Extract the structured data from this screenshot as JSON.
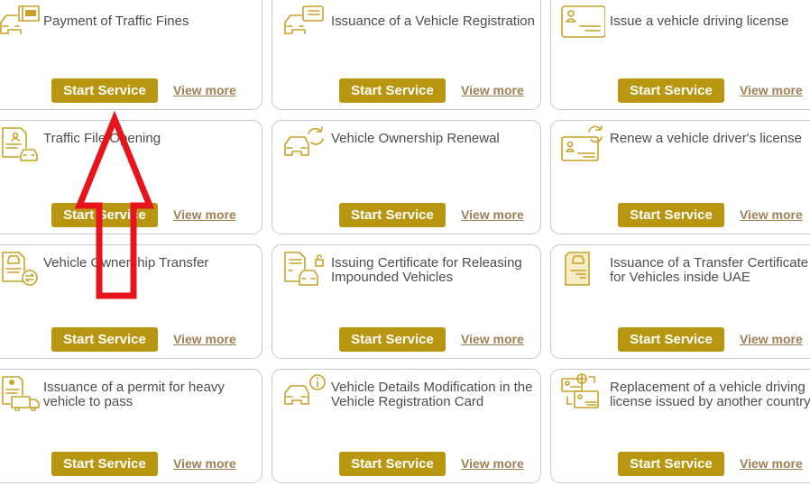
{
  "accent_color": "#b8960f",
  "link_color": "#a07f55",
  "annotation_color": "#e8141c",
  "services": [
    {
      "title": "Payment of Traffic Fines",
      "icon": "car-aed-ticket-icon",
      "start_label": "Start Service",
      "view_label": "View more"
    },
    {
      "title": "Issuance of a Vehicle Registration",
      "icon": "car-registration-card-icon",
      "start_label": "Start Service",
      "view_label": "View more"
    },
    {
      "title": "Issue a vehicle driving license",
      "icon": "driving-license-card-icon",
      "start_label": "Start Service",
      "view_label": "View more"
    },
    {
      "title": "Traffic File Opening",
      "icon": "document-car-icon",
      "start_label": "Start Service",
      "view_label": "View more"
    },
    {
      "title": "Vehicle Ownership Renewal",
      "icon": "car-renew-icon",
      "start_label": "Start Service",
      "view_label": "View more"
    },
    {
      "title": "Renew a vehicle driver's license",
      "icon": "license-renew-icon",
      "start_label": "Start Service",
      "view_label": "View more"
    },
    {
      "title": "Vehicle Ownership Transfer",
      "icon": "document-transfer-icon",
      "start_label": "Start Service",
      "view_label": "View more"
    },
    {
      "title": "Issuing Certificate for Releasing\nImpounded Vehicles",
      "icon": "certificate-car-lock-icon",
      "start_label": "Start Service",
      "view_label": "View more"
    },
    {
      "title": "Issuance of a Transfer Certificate\nfor Vehicles inside UAE",
      "icon": "document-car-certificate-icon",
      "start_label": "Start Service",
      "view_label": "View more"
    },
    {
      "title": "Issuance of a permit for heavy\nvehicle to pass",
      "icon": "permit-truck-icon",
      "start_label": "Start Service",
      "view_label": "View more"
    },
    {
      "title": "Vehicle Details Modification in the\nVehicle Registration Card",
      "icon": "car-info-icon",
      "start_label": "Start Service",
      "view_label": "View more"
    },
    {
      "title": "Replacement of a vehicle driving\nlicense issued by another country",
      "icon": "license-exchange-globe-icon",
      "start_label": "Start Service",
      "view_label": "View more"
    }
  ],
  "annotation": {
    "type": "red-up-arrow",
    "points_to": "Start Service (Payment of Traffic Fines)"
  }
}
